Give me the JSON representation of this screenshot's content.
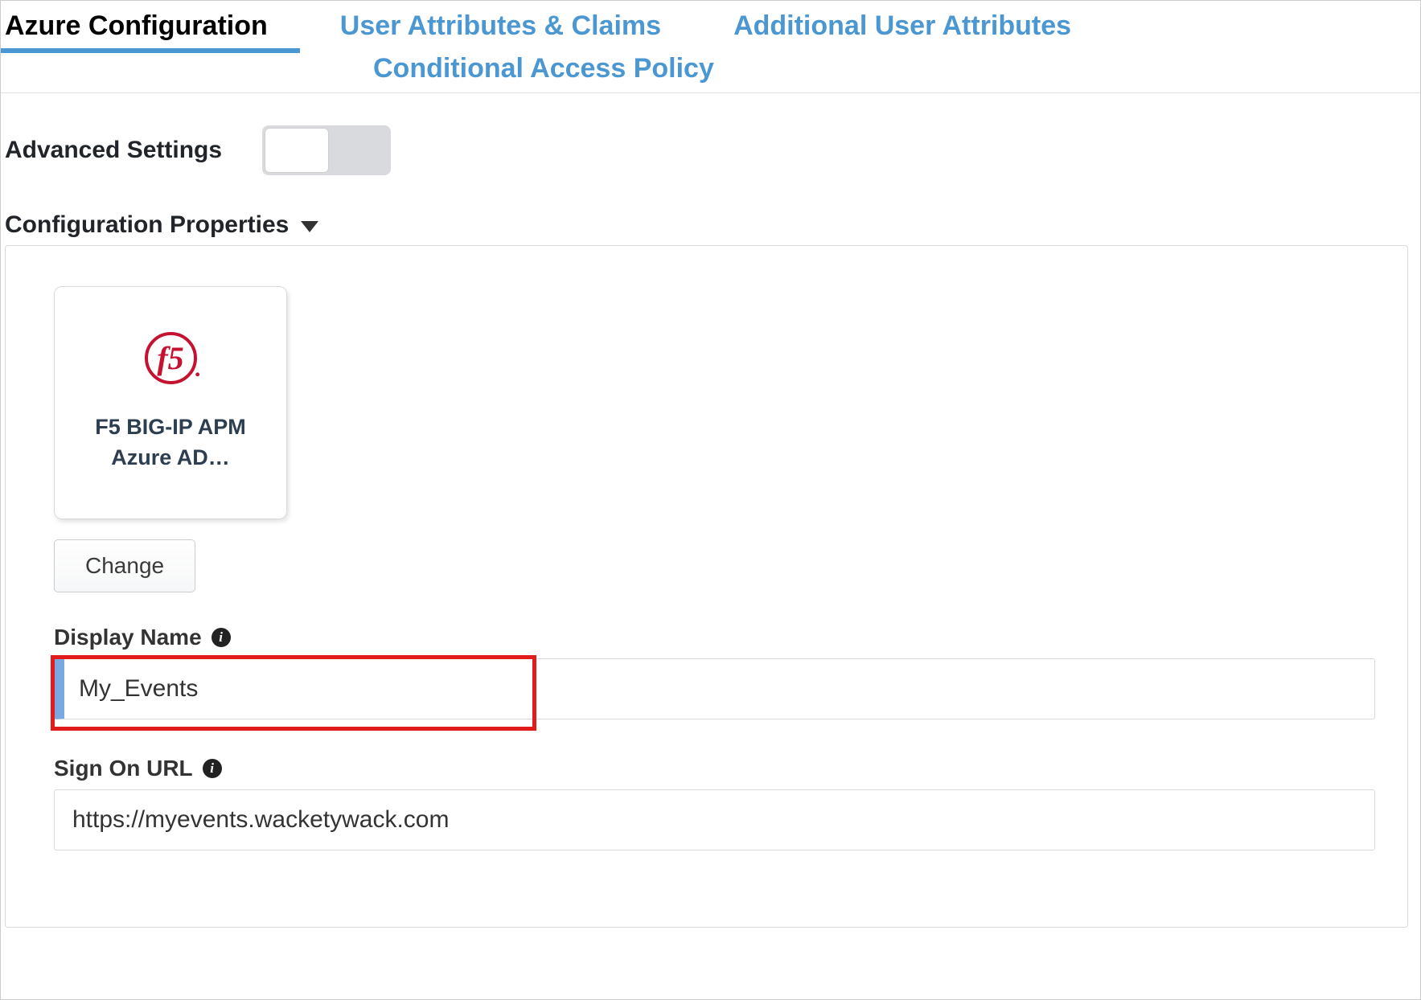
{
  "tabs": {
    "azure_config": "Azure Configuration",
    "user_attrs": "User Attributes & Claims",
    "additional_attrs": "Additional User Attributes",
    "conditional_access": "Conditional Access Policy"
  },
  "advanced_settings_label": "Advanced Settings",
  "section_title": "Configuration Properties",
  "app_card": {
    "line1": "F5 BIG-IP APM",
    "line2": "Azure AD…"
  },
  "change_button": "Change",
  "fields": {
    "display_name": {
      "label": "Display Name",
      "value": "My_Events"
    },
    "sign_on_url": {
      "label": "Sign On URL",
      "value": "https://myevents.wacketywack.com"
    }
  }
}
